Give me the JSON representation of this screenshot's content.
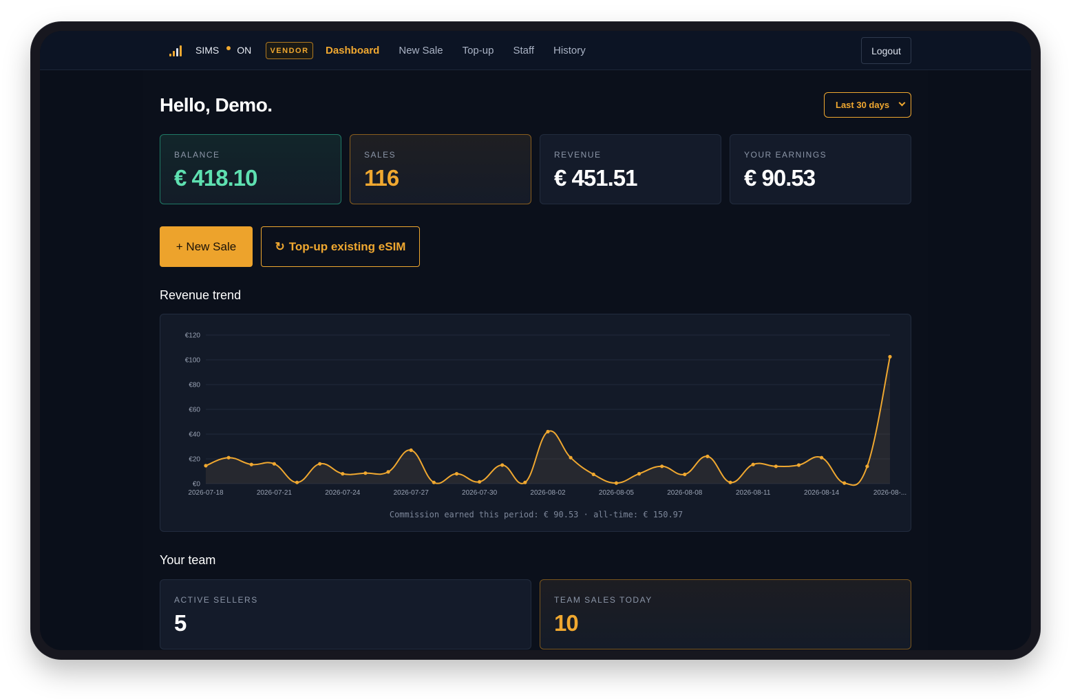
{
  "brand": {
    "name": "SIMS",
    "status": "ON"
  },
  "badge": "VENDOR",
  "nav": [
    {
      "label": "Dashboard",
      "active": true
    },
    {
      "label": "New Sale",
      "active": false
    },
    {
      "label": "Top-up",
      "active": false
    },
    {
      "label": "Staff",
      "active": false
    },
    {
      "label": "History",
      "active": false
    }
  ],
  "logout": "Logout",
  "greeting": "Hello, Demo.",
  "range": {
    "selected": "Last 30 days"
  },
  "stats": {
    "balance": {
      "label": "BALANCE",
      "value": "€ 418.10"
    },
    "sales": {
      "label": "SALES",
      "value": "116"
    },
    "revenue": {
      "label": "REVENUE",
      "value": "€ 451.51"
    },
    "earnings": {
      "label": "YOUR EARNINGS",
      "value": "€ 90.53"
    }
  },
  "actions": {
    "new_sale": "+ New Sale",
    "topup": "Top-up existing eSIM",
    "topup_icon": "refresh-icon"
  },
  "revenue_section": {
    "title": "Revenue trend"
  },
  "commission_text": "Commission earned this period: € 90.53 · all-time: € 150.97",
  "team": {
    "title": "Your team",
    "active_sellers": {
      "label": "ACTIVE SELLERS",
      "value": "5"
    },
    "team_sales": {
      "label": "TEAM SALES TODAY",
      "value": "10"
    }
  },
  "colors": {
    "accent": "#f0a830",
    "positive": "#5ee0b0",
    "background": "#0a0f1a"
  },
  "chart_data": {
    "type": "area",
    "x": [
      "2026-07-18",
      "2026-07-19",
      "2026-07-20",
      "2026-07-21",
      "2026-07-22",
      "2026-07-23",
      "2026-07-24",
      "2026-07-25",
      "2026-07-26",
      "2026-07-27",
      "2026-07-28",
      "2026-07-29",
      "2026-07-30",
      "2026-07-31",
      "2026-08-01",
      "2026-08-02",
      "2026-08-03",
      "2026-08-04",
      "2026-08-05",
      "2026-08-06",
      "2026-08-07",
      "2026-08-08",
      "2026-08-09",
      "2026-08-10",
      "2026-08-11",
      "2026-08-12",
      "2026-08-13",
      "2026-08-14",
      "2026-08-15",
      "2026-08-16",
      "2026-08-17"
    ],
    "values": [
      14.5,
      21,
      15.5,
      16,
      1,
      16,
      8,
      8.5,
      9.5,
      27,
      1,
      8,
      1.5,
      15,
      1,
      42,
      21,
      7.5,
      0.5,
      8,
      14,
      7.5,
      22,
      1,
      15.5,
      14,
      15,
      21,
      0.5,
      14,
      102.5
    ],
    "tick_labels": [
      "2026-07-18",
      "2026-07-21",
      "2026-07-24",
      "2026-07-27",
      "2026-07-30",
      "2026-08-02",
      "2026-08-05",
      "2026-08-08",
      "2026-08-11",
      "2026-08-14",
      "2026-08-..."
    ],
    "y_ticks": [
      "€0",
      "€20",
      "€40",
      "€60",
      "€80",
      "€100",
      "€120"
    ],
    "ylim": [
      0,
      120
    ],
    "grid": true
  }
}
